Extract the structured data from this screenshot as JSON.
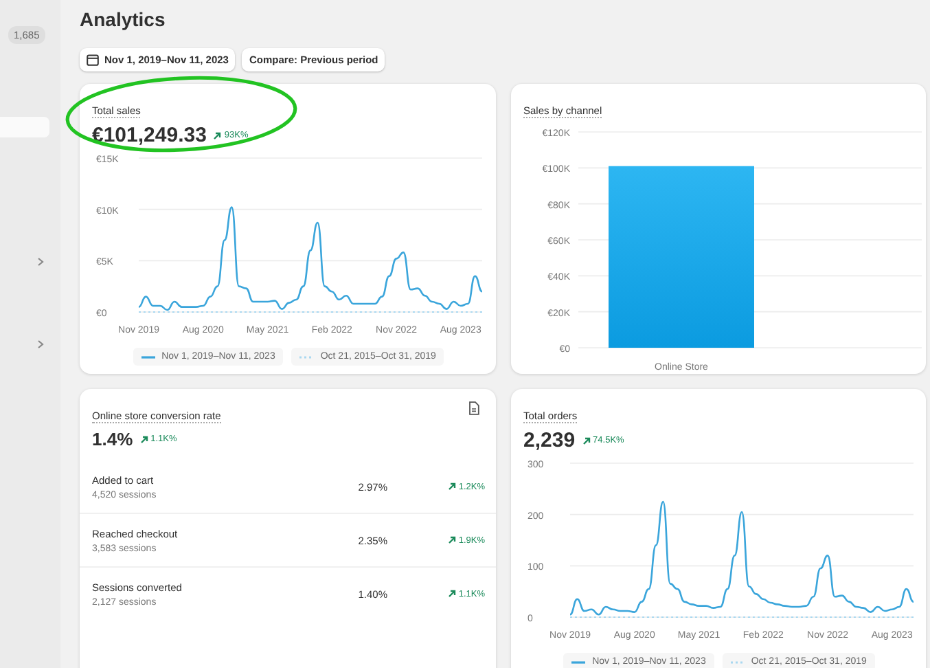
{
  "sidebar": {
    "badge": "1,685"
  },
  "page": {
    "title": "Analytics"
  },
  "filters": [
    {
      "label": "Nov 1, 2019–Nov 11, 2023",
      "kind": "date"
    },
    {
      "label": "Compare: Previous period",
      "kind": "plain"
    }
  ],
  "cards": [
    {
      "kind": "line",
      "title": "Total sales",
      "value": "€101,249.33",
      "change": "93K%",
      "chart_data": {
        "type": "line",
        "grid": true,
        "categories": [
          "Nov 2019",
          null,
          null,
          null,
          null,
          null,
          null,
          null,
          null,
          "Aug 2020",
          null,
          null,
          null,
          null,
          null,
          null,
          null,
          null,
          "May 2021",
          null,
          null,
          null,
          null,
          null,
          null,
          null,
          null,
          "Feb 2022",
          null,
          null,
          null,
          null,
          null,
          null,
          null,
          null,
          "Nov 2022",
          null,
          null,
          null,
          null,
          null,
          null,
          null,
          null,
          "Aug 2023",
          null,
          null,
          null
        ],
        "ylim": [
          0,
          15000
        ],
        "yticks": [
          {
            "value": 0,
            "label": "€0"
          },
          {
            "value": 5000,
            "label": "€5K"
          },
          {
            "value": 10000,
            "label": "€10K"
          },
          {
            "value": 15000,
            "label": "€15K"
          }
        ],
        "series": [
          {
            "name": "Nov 1, 2019–Nov 11, 2023",
            "color": "#3aa5db",
            "line_style": "solid",
            "values": [
              500,
              1500,
              600,
              600,
              200,
              1000,
              500,
              500,
              500,
              600,
              1500,
              2500,
              7000,
              10200,
              2500,
              2300,
              1000,
              1000,
              1000,
              1100,
              300,
              900,
              1200,
              2500,
              6000,
              8700,
              2500,
              2000,
              1200,
              1600,
              800,
              800,
              800,
              800,
              1500,
              3500,
              5200,
              5800,
              2200,
              2300,
              1600,
              1000,
              800,
              300,
              1000,
              600,
              800,
              3500,
              2000
            ]
          },
          {
            "name": "Oct 21, 2015–Oct 31, 2019",
            "color": "#a9d8f0",
            "line_style": "dotted",
            "values": [
              0,
              0,
              0,
              0,
              0,
              0,
              0,
              0,
              0,
              0,
              0,
              0,
              0,
              0,
              0,
              0,
              0,
              0,
              0,
              0,
              0,
              0,
              0,
              0,
              0,
              0,
              0,
              0,
              0,
              0,
              0,
              0,
              0,
              0,
              0,
              0,
              0,
              0,
              0,
              0,
              0,
              0,
              0,
              0,
              0,
              0,
              0,
              0,
              0
            ]
          }
        ]
      }
    },
    {
      "kind": "bar",
      "title": "Sales by channel",
      "chart_data": {
        "type": "bar",
        "grid": true,
        "categories": [
          "Online Store"
        ],
        "values": [
          101000
        ],
        "ylim": [
          0,
          120000
        ],
        "yticks": [
          {
            "value": 0,
            "label": "€0"
          },
          {
            "value": 20000,
            "label": "€20K"
          },
          {
            "value": 40000,
            "label": "€40K"
          },
          {
            "value": 60000,
            "label": "€60K"
          },
          {
            "value": 80000,
            "label": "€80K"
          },
          {
            "value": 100000,
            "label": "€100K"
          },
          {
            "value": 120000,
            "label": "€120K"
          }
        ]
      }
    },
    {
      "kind": "conversion",
      "title": "Online store conversion rate",
      "value": "1.4%",
      "change": "1.1K%",
      "rows": [
        {
          "label": "Added to cart",
          "sessions": "4,520 sessions",
          "rate": "2.97%",
          "change": "1.2K%"
        },
        {
          "label": "Reached checkout",
          "sessions": "3,583 sessions",
          "rate": "2.35%",
          "change": "1.9K%"
        },
        {
          "label": "Sessions converted",
          "sessions": "2,127 sessions",
          "rate": "1.40%",
          "change": "1.1K%"
        }
      ]
    },
    {
      "kind": "line",
      "title": "Total orders",
      "value": "2,239",
      "change": "74.5K%",
      "chart_data": {
        "type": "line",
        "grid": true,
        "categories": [
          "Nov 2019",
          null,
          null,
          null,
          null,
          null,
          null,
          null,
          null,
          "Aug 2020",
          null,
          null,
          null,
          null,
          null,
          null,
          null,
          null,
          "May 2021",
          null,
          null,
          null,
          null,
          null,
          null,
          null,
          null,
          "Feb 2022",
          null,
          null,
          null,
          null,
          null,
          null,
          null,
          null,
          "Nov 2022",
          null,
          null,
          null,
          null,
          null,
          null,
          null,
          null,
          "Aug 2023",
          null,
          null,
          null
        ],
        "ylim": [
          0,
          300
        ],
        "yticks": [
          0,
          100,
          200,
          300
        ],
        "series": [
          {
            "name": "Nov 1, 2019–Nov 11, 2023",
            "color": "#3aa5db",
            "line_style": "solid",
            "values": [
              5,
              35,
              12,
              15,
              5,
              20,
              15,
              12,
              12,
              10,
              30,
              55,
              140,
              225,
              65,
              55,
              30,
              25,
              22,
              22,
              18,
              20,
              55,
              120,
              205,
              60,
              45,
              35,
              28,
              25,
              22,
              20,
              20,
              22,
              40,
              95,
              120,
              40,
              42,
              30,
              20,
              18,
              10,
              20,
              12,
              15,
              20,
              55,
              30
            ]
          },
          {
            "name": "Oct 21, 2015–Oct 31, 2019",
            "color": "#a9d8f0",
            "line_style": "dotted",
            "values": [
              0,
              0,
              0,
              0,
              0,
              0,
              0,
              0,
              0,
              0,
              0,
              0,
              0,
              0,
              0,
              0,
              0,
              0,
              0,
              0,
              0,
              0,
              0,
              0,
              0,
              0,
              0,
              0,
              0,
              0,
              0,
              0,
              0,
              0,
              0,
              0,
              0,
              0,
              0,
              0,
              0,
              0,
              0,
              0,
              0,
              0,
              0,
              0,
              0
            ]
          }
        ]
      }
    }
  ]
}
